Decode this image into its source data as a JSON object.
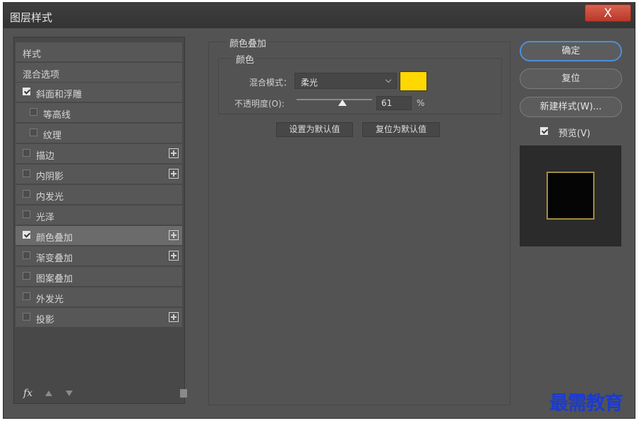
{
  "window": {
    "title": "图层样式",
    "close_label": "X"
  },
  "left_panel": {
    "items": [
      {
        "label": "样式",
        "checkbox": false,
        "checked": false,
        "plus": false,
        "indent": false,
        "selected": false
      },
      {
        "label": "混合选项",
        "checkbox": false,
        "checked": false,
        "plus": false,
        "indent": false,
        "selected": false
      },
      {
        "label": "斜面和浮雕",
        "checkbox": true,
        "checked": true,
        "plus": false,
        "indent": false,
        "selected": false
      },
      {
        "label": "等高线",
        "checkbox": true,
        "checked": false,
        "plus": false,
        "indent": true,
        "selected": false
      },
      {
        "label": "纹理",
        "checkbox": true,
        "checked": false,
        "plus": false,
        "indent": true,
        "selected": false
      },
      {
        "label": "描边",
        "checkbox": true,
        "checked": false,
        "plus": true,
        "indent": false,
        "selected": false
      },
      {
        "label": "内阴影",
        "checkbox": true,
        "checked": false,
        "plus": true,
        "indent": false,
        "selected": false
      },
      {
        "label": "内发光",
        "checkbox": true,
        "checked": false,
        "plus": false,
        "indent": false,
        "selected": false
      },
      {
        "label": "光泽",
        "checkbox": true,
        "checked": false,
        "plus": false,
        "indent": false,
        "selected": false
      },
      {
        "label": "颜色叠加",
        "checkbox": true,
        "checked": true,
        "plus": true,
        "indent": false,
        "selected": true
      },
      {
        "label": "渐变叠加",
        "checkbox": true,
        "checked": false,
        "plus": true,
        "indent": false,
        "selected": false
      },
      {
        "label": "图案叠加",
        "checkbox": true,
        "checked": false,
        "plus": false,
        "indent": false,
        "selected": false
      },
      {
        "label": "外发光",
        "checkbox": true,
        "checked": false,
        "plus": false,
        "indent": false,
        "selected": false
      },
      {
        "label": "投影",
        "checkbox": true,
        "checked": false,
        "plus": true,
        "indent": false,
        "selected": false
      }
    ],
    "fx_label": "fx"
  },
  "color_overlay": {
    "section_title": "颜色叠加",
    "group_title": "颜色",
    "blend_mode_label": "混合模式：",
    "blend_mode_value": "柔光",
    "overlay_color": "#ffd800",
    "opacity_label": "不透明度(O):",
    "opacity_value": "61",
    "opacity_unit": "%",
    "opacity_level": 0.61,
    "set_default_label": "设置为默认值",
    "reset_default_label": "复位为默认值"
  },
  "right_panel": {
    "ok_label": "确定",
    "reset_label": "复位",
    "new_style_label": "新建样式(W)...",
    "preview_label": "预览(V)",
    "preview_checked": true
  },
  "watermark": "最需教育"
}
